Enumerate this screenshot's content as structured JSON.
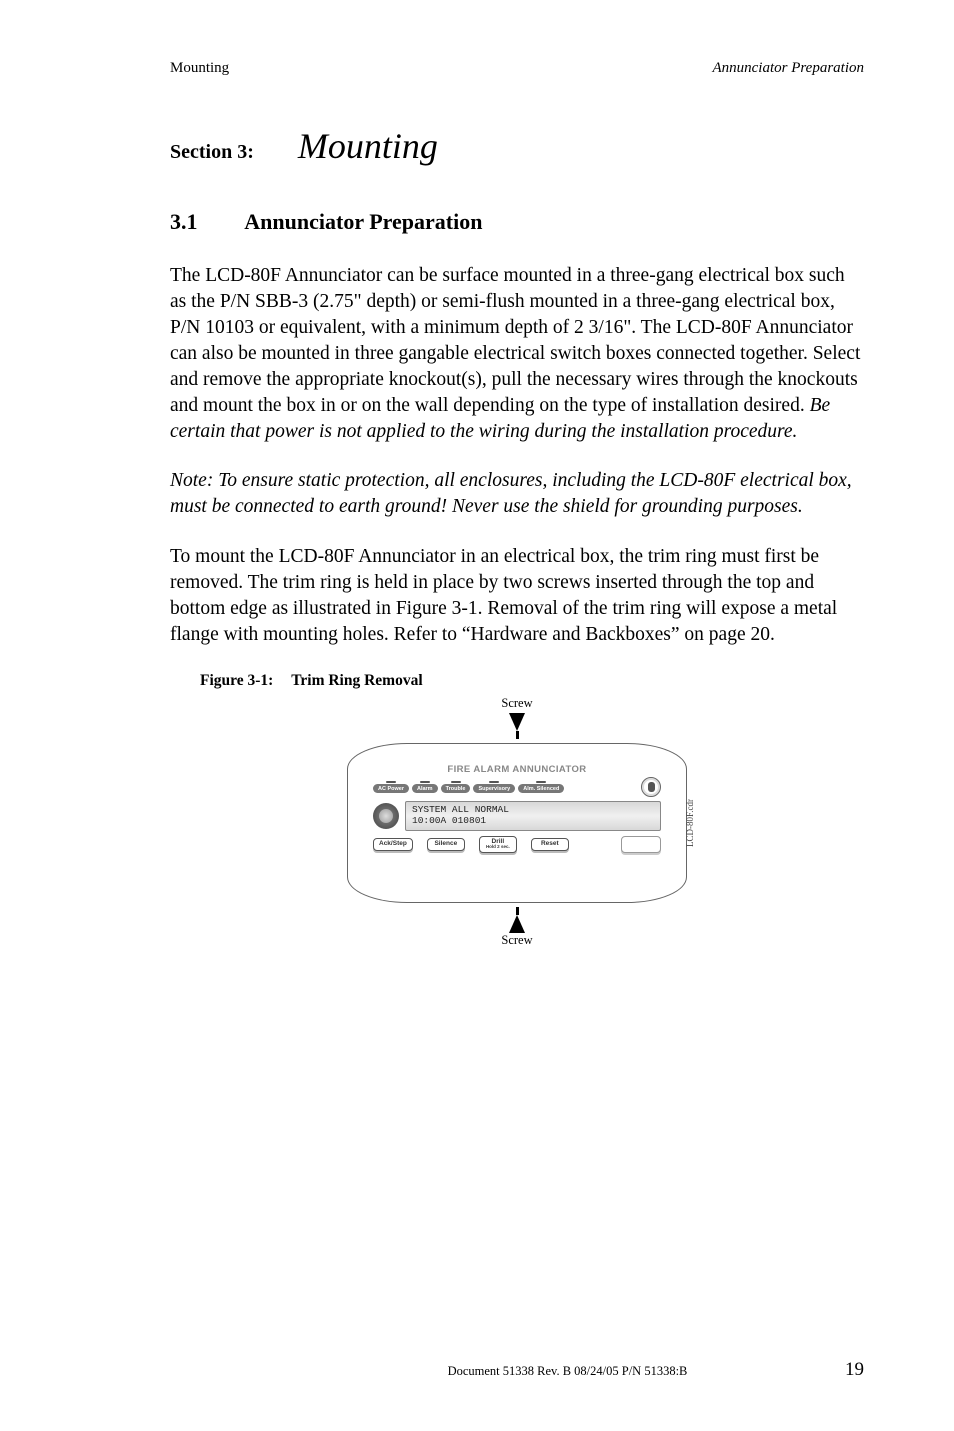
{
  "header": {
    "left": "Mounting",
    "right": "Annunciator Preparation"
  },
  "section": {
    "label": "Section 3:",
    "title": "Mounting"
  },
  "subsection": {
    "number": "3.1",
    "title": "Annunciator Preparation"
  },
  "paragraphs": {
    "p1a": "The LCD-80F Annunciator can be surface mounted in a three-gang electrical box such as the P/N SBB-3 (2.75\" depth) or semi-flush mounted in a three-gang electrical box, P/N 10103 or equivalent, with a minimum depth of 2 3/16\". The LCD-80F Annunciator can also be mounted in three gangable electrical switch boxes connected together. Select and remove the appropriate knockout(s), pull the necessary wires through the knockouts and mount the box in or on the wall depending on the type of installation desired. ",
    "p1b": "Be certain that power is not applied to the wiring during the installation procedure.",
    "p2": "Note: To ensure static protection, all enclosures, including the LCD-80F electrical box, must be connected to earth ground! Never use the shield for grounding purposes.",
    "p3": "To mount the LCD-80F Annunciator in an electrical box, the trim ring must first be removed. The trim ring is held in place by two screws inserted through the top and bottom edge as illustrated in Figure 3-1. Removal of the trim ring will expose a metal flange with mounting holes. Refer to “Hardware and Backboxes” on page 20."
  },
  "figure": {
    "caption_label": "Figure 3-1:",
    "caption_text": "Trim Ring Removal",
    "screw_top": "Screw",
    "screw_bottom": "Screw",
    "side_text": "LCD-80F.cdr",
    "device": {
      "title": "FIRE ALARM ANNUNCIATOR",
      "status": [
        "AC Power",
        "Alarm",
        "Trouble",
        "Supervisory",
        "Alm. Silenced"
      ],
      "lcd_line1": "SYSTEM ALL NORMAL",
      "lcd_line2": "10:00A 010801",
      "buttons": {
        "b1": "Ack/Step",
        "b2": "Silence",
        "b3_main": "Drill",
        "b3_sub": "Hold 2 sec.",
        "b4": "Reset"
      }
    }
  },
  "footer": {
    "center": "Document 51338   Rev. B   08/24/05   P/N 51338:B",
    "page": "19"
  }
}
